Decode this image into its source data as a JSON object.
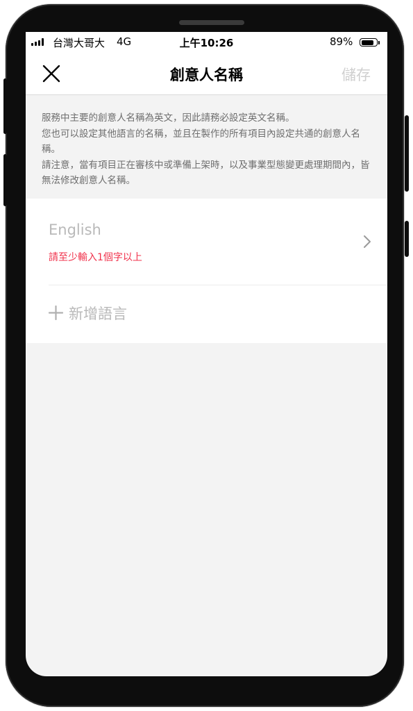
{
  "status_bar": {
    "carrier": "台灣大哥大",
    "network": "4G",
    "time": "上午10:26",
    "battery": "89%",
    "battery_level": 0.89
  },
  "nav": {
    "title": "創意人名稱",
    "save_label": "儲存",
    "close_icon": "close-icon"
  },
  "description": {
    "lines": [
      "服務中主要的創意人名稱為英文，因此請務必設定英文名稱。",
      "您也可以設定其他語言的名稱，並且在製作的所有項目內設定共通的創意人名稱。",
      "請注意，當有項目正在審核中或準備上架時，以及事業型態變更處理期間內，皆無法修改創意人名稱。"
    ]
  },
  "language_entry": {
    "name": "English",
    "error": "請至少輸入1個字以上",
    "icon": "chevron-right-icon"
  },
  "add_language": {
    "label": "新增語言",
    "icon": "plus-icon"
  },
  "colors": {
    "error": "#f0314b",
    "placeholder": "#b9b9b9",
    "background": "#f3f3f3"
  }
}
